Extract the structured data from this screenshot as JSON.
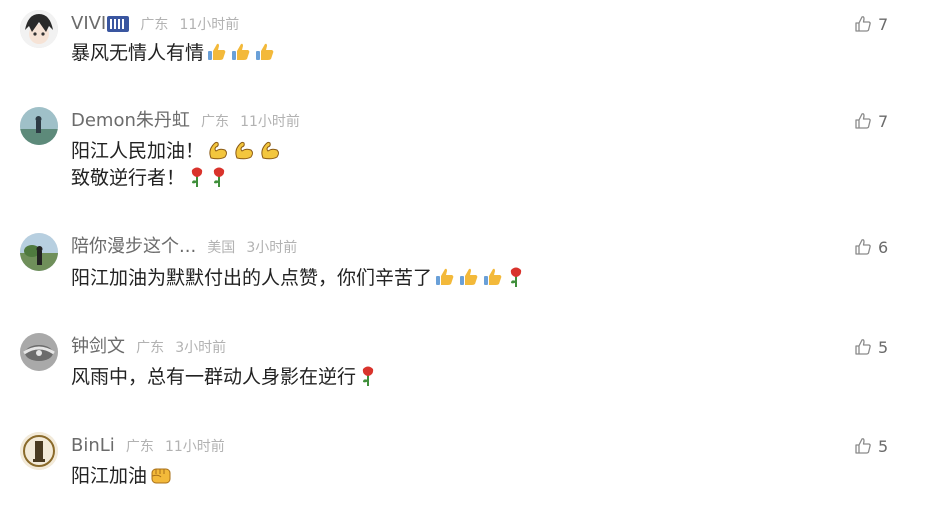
{
  "comments": [
    {
      "username": "VIVI",
      "location": "广东",
      "time": "11小时前",
      "lines": [
        "暴风无情人有情"
      ],
      "likes": "7",
      "emoji": [
        [
          "thumbs-up",
          "thumbs-up",
          "thumbs-up"
        ]
      ]
    },
    {
      "username": "Demon朱丹虹",
      "location": "广东",
      "time": "11小时前",
      "lines": [
        "阳江人民加油！",
        "致敬逆行者！"
      ],
      "likes": "7",
      "emoji": [
        [
          "flexed-biceps",
          "flexed-biceps",
          "flexed-biceps"
        ],
        [
          "rose",
          "rose"
        ]
      ]
    },
    {
      "username": "陪你漫步这个...",
      "location": "美国",
      "time": "3小时前",
      "lines": [
        "阳江加油为默默付出的人点赞，你们辛苦了"
      ],
      "likes": "6",
      "emoji": [
        [
          "thumbs-up",
          "thumbs-up",
          "thumbs-up",
          "rose"
        ]
      ]
    },
    {
      "username": "钟剑文",
      "location": "广东",
      "time": "3小时前",
      "lines": [
        "风雨中，总有一群动人身影在逆行"
      ],
      "likes": "5",
      "emoji": [
        [
          "rose"
        ]
      ]
    },
    {
      "username": "BinLi",
      "location": "广东",
      "time": "11小时前",
      "lines": [
        "阳江加油"
      ],
      "likes": "5",
      "emoji": [
        [
          "fist"
        ]
      ]
    }
  ],
  "colors": {
    "thumb": "#f3b93a",
    "rose": "#d9332c",
    "biceps": "#f3c63d",
    "like_icon": "#8a8a8a"
  }
}
